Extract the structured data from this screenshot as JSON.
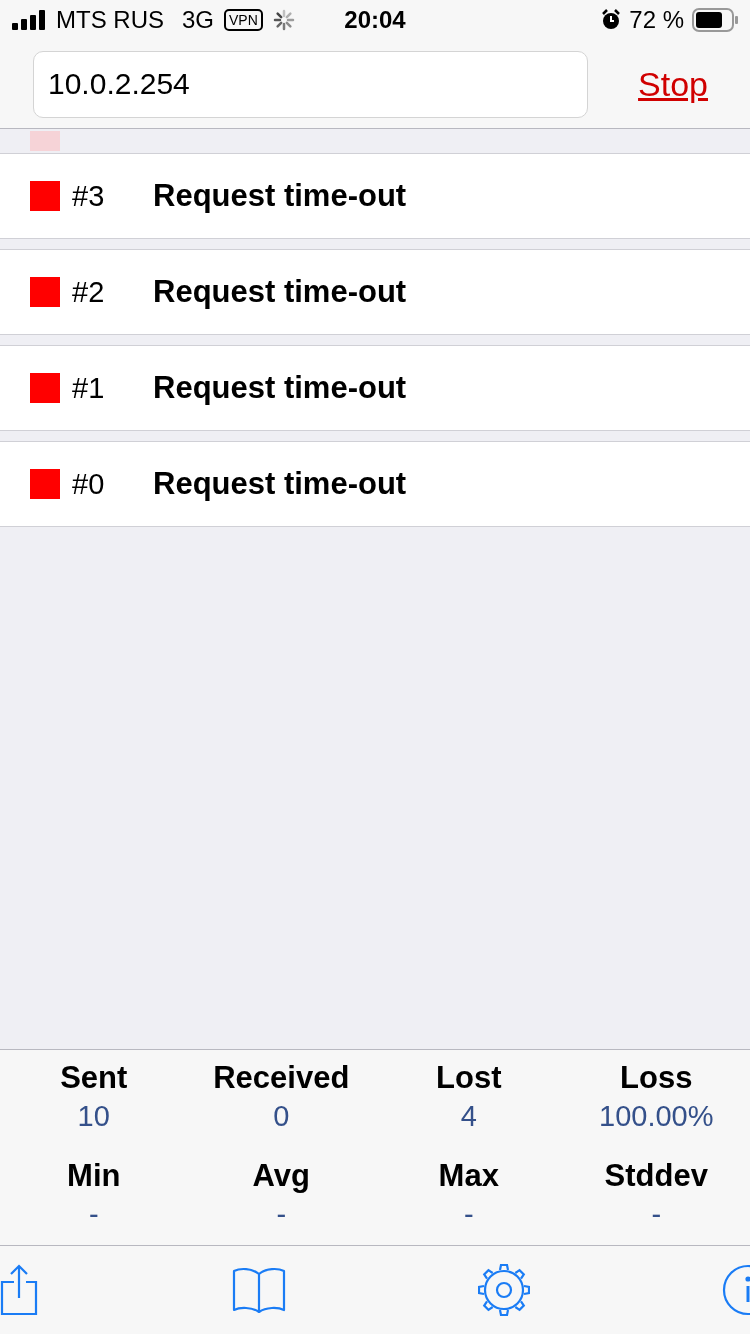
{
  "status_bar": {
    "carrier": "MTS RUS",
    "network": "3G",
    "vpn": "VPN",
    "time": "20:04",
    "battery": "72 %"
  },
  "header": {
    "host": "10.0.2.254",
    "action": "Stop"
  },
  "results": [
    {
      "color": "#f6d3d7",
      "kind": "partial"
    },
    {
      "index": "#3",
      "message": "Request time-out",
      "color": "#ff0000",
      "kind": "full"
    },
    {
      "index": "#2",
      "message": "Request time-out",
      "color": "#ff0000",
      "kind": "full"
    },
    {
      "index": "#1",
      "message": "Request time-out",
      "color": "#ff0000",
      "kind": "full"
    },
    {
      "index": "#0",
      "message": "Request time-out",
      "color": "#ff0000",
      "kind": "full"
    }
  ],
  "stats": [
    {
      "label": "Sent",
      "value": "10"
    },
    {
      "label": "Received",
      "value": "0"
    },
    {
      "label": "Lost",
      "value": "4"
    },
    {
      "label": "Loss",
      "value": "100.00%"
    },
    {
      "label": "Min",
      "value": "-"
    },
    {
      "label": "Avg",
      "value": "-"
    },
    {
      "label": "Max",
      "value": "-"
    },
    {
      "label": "Stddev",
      "value": "-"
    }
  ]
}
